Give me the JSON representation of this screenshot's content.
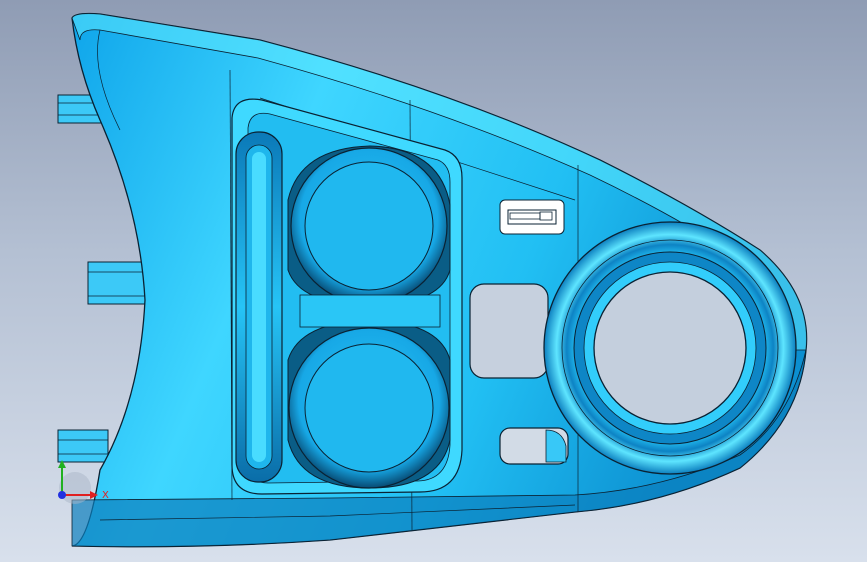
{
  "viewport": {
    "background_top": "#8f9cb4",
    "background_bottom": "#d8e0ec"
  },
  "part": {
    "body_color": "#19b5f0",
    "highlight_color": "#5fe9ff",
    "shadow_color": "#0a5d86",
    "edge_color": "#0a2233"
  },
  "triad": {
    "x_label": "X",
    "x_color": "#e02020",
    "y_color": "#20b020",
    "z_color": "#2030e0"
  }
}
